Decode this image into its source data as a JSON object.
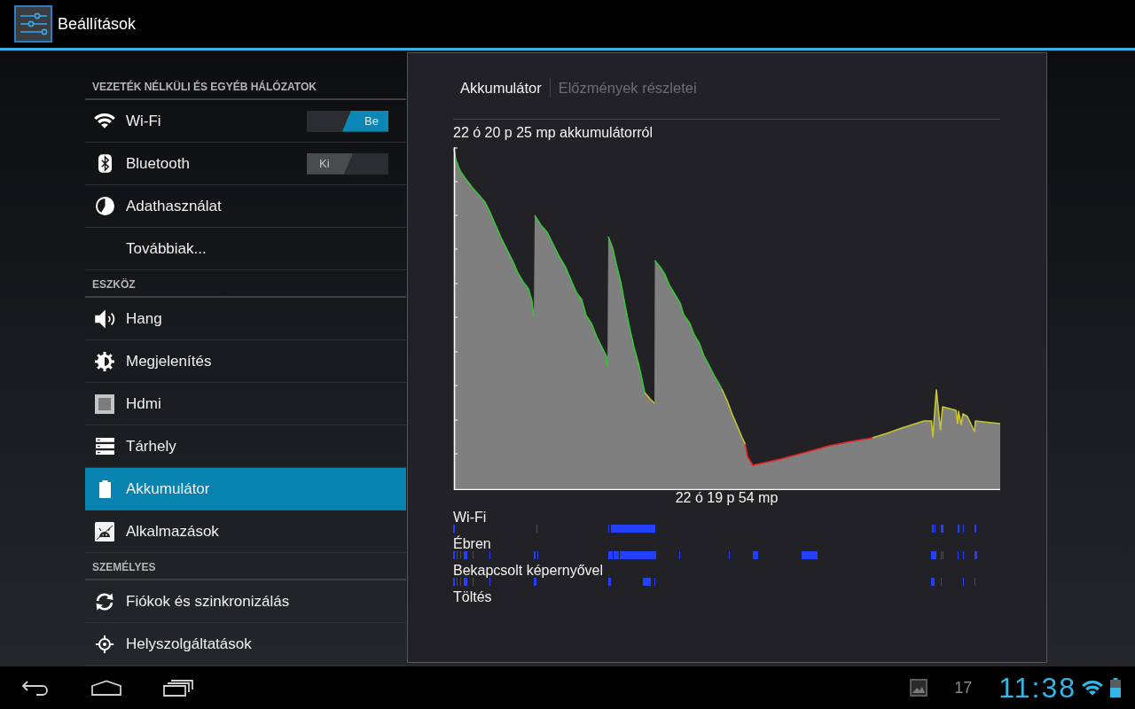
{
  "action_bar": {
    "title": "Beállítások"
  },
  "sidebar": {
    "sections": [
      {
        "heading": "VEZETÉK NÉLKÜLI ÉS EGYÉB HÁLÓZATOK",
        "items": [
          {
            "kind": "toggle",
            "label": "Wi-Fi",
            "on": true,
            "switch_text": "Be",
            "selected": false
          },
          {
            "kind": "toggle",
            "label": "Bluetooth",
            "on": false,
            "switch_text": "Ki",
            "selected": false
          },
          {
            "kind": "plain",
            "label": "Adathasználat",
            "selected": false
          },
          {
            "kind": "plain",
            "label": "Továbbiak...",
            "selected": false
          }
        ]
      },
      {
        "heading": "ESZKÖZ",
        "items": [
          {
            "kind": "plain",
            "label": "Hang",
            "selected": false
          },
          {
            "kind": "plain",
            "label": "Megjelenítés",
            "selected": false
          },
          {
            "kind": "plain",
            "label": "Hdmi",
            "selected": false
          },
          {
            "kind": "plain",
            "label": "Tárhely",
            "selected": false
          },
          {
            "kind": "plain",
            "label": "Akkumulátor",
            "selected": true
          },
          {
            "kind": "plain",
            "label": "Alkalmazások",
            "selected": false
          }
        ]
      },
      {
        "heading": "SZEMÉLYES",
        "items": [
          {
            "kind": "plain",
            "label": "Fiókok és szinkronizálás",
            "selected": false
          },
          {
            "kind": "plain",
            "label": "Helyszolgáltatások",
            "selected": false
          }
        ]
      }
    ]
  },
  "detail": {
    "breadcrumbs": [
      {
        "label": "Akkumulátor",
        "selected": true
      },
      {
        "label": "Előzmények részletei",
        "selected": false
      }
    ],
    "chart_title": "22 ó 20 p 25 mp akkumulátorról",
    "chart_time": "22 ó 19 p 54 mp",
    "activity_rows": [
      {
        "label": "Wi-Fi"
      },
      {
        "label": "Ébren"
      },
      {
        "label": "Bekapcsolt képernyővel"
      },
      {
        "label": "Töltés"
      }
    ]
  },
  "system_bar": {
    "status_text": "17",
    "clock": "11:38"
  }
}
